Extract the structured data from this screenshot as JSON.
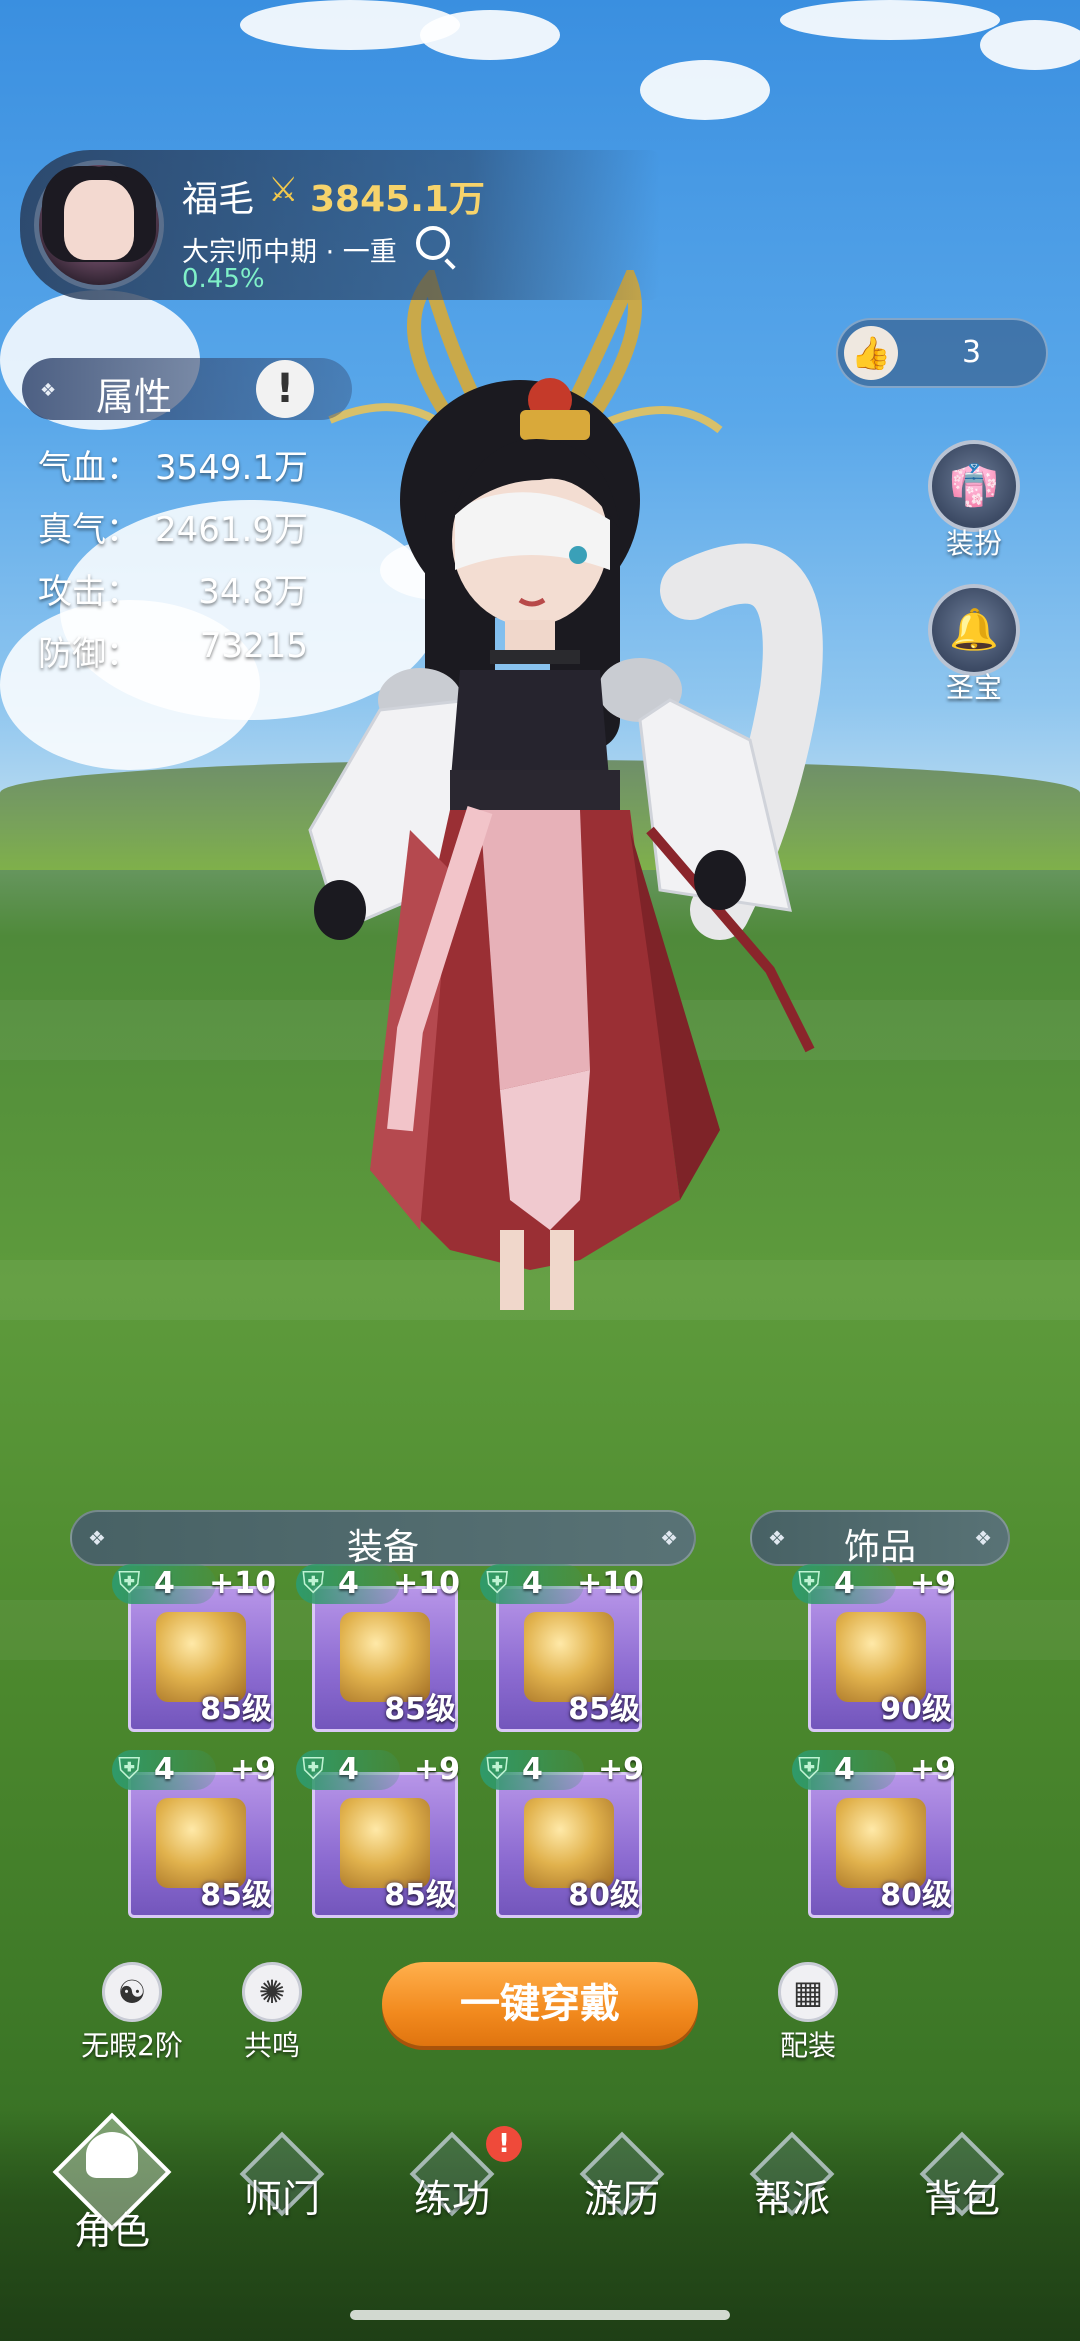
{
  "player": {
    "name": "福毛",
    "power_icon": "crossed-swords-icon",
    "power": "3845.1万",
    "rank": "大宗师中期 · 一重",
    "progress": "0.45%"
  },
  "likes": {
    "count": "3",
    "icon": "thumbs-up-icon"
  },
  "attributes": {
    "title": "属性",
    "info_icon": "!",
    "stats": [
      {
        "label": "气血：",
        "value": "3549.1万"
      },
      {
        "label": "真气：",
        "value": "2461.9万"
      },
      {
        "label": "攻击：",
        "value": "34.8万"
      },
      {
        "label": "防御：",
        "value": "73215"
      }
    ]
  },
  "side_buttons": [
    {
      "label": "装扮",
      "icon": "robe-icon"
    },
    {
      "label": "圣宝",
      "icon": "bell-icon"
    }
  ],
  "equipment": {
    "title": "装备",
    "slots": [
      {
        "tier": "4",
        "plus": "+10",
        "level": "85级",
        "icon": "sword-icon"
      },
      {
        "tier": "4",
        "plus": "+10",
        "level": "85级",
        "icon": "helmet-icon"
      },
      {
        "tier": "4",
        "plus": "+10",
        "level": "85级",
        "icon": "armor-icon"
      },
      {
        "tier": "4",
        "plus": "+9",
        "level": "85级",
        "icon": "belt-icon"
      },
      {
        "tier": "4",
        "plus": "+9",
        "level": "85级",
        "icon": "bracer-icon"
      },
      {
        "tier": "4",
        "plus": "+9",
        "level": "80级",
        "icon": "boots-icon"
      }
    ]
  },
  "accessories": {
    "title": "饰品",
    "slots": [
      {
        "tier": "4",
        "plus": "+9",
        "level": "90级",
        "icon": "ring-icon"
      },
      {
        "tier": "4",
        "plus": "+9",
        "level": "80级",
        "icon": "amulet-icon"
      }
    ]
  },
  "actions": {
    "wuxia": "无暇2阶",
    "resonance": "共鸣",
    "equip_all": "一键穿戴",
    "loadout": "配装"
  },
  "nav": {
    "items": [
      "角色",
      "师门",
      "练功",
      "游历",
      "帮派",
      "背包"
    ],
    "active": "角色",
    "alert": "!"
  },
  "colors": {
    "accent_orange": "#f28a1e",
    "power_gold": "#f6d36b",
    "progress_green": "#7ff0c8",
    "slot_purple": "#8c6bd1"
  }
}
